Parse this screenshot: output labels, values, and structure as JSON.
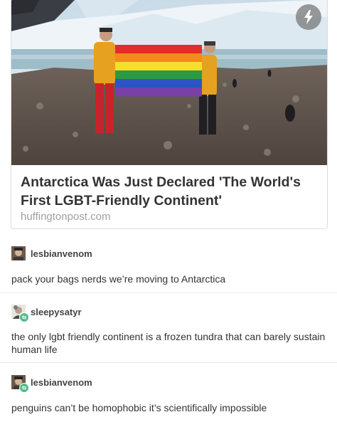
{
  "link_card": {
    "title": "Antarctica Was Just Declared 'The World's First LGBT-Friendly Continent'",
    "source": "huffingtonpost.com",
    "flag_colors": [
      "#e52b2b",
      "#f28a1c",
      "#f7de2b",
      "#2a9a46",
      "#2a55c8",
      "#7b3fa8"
    ]
  },
  "posts": [
    {
      "username": "lesbianvenom",
      "text": "pack your bags nerds we’re moving to Antarctica",
      "reblogged": false
    },
    {
      "username": "sleepysatyr",
      "text": "the only lgbt friendly continent is a frozen tundra that can barely sustain human life",
      "reblogged": true
    },
    {
      "username": "lesbianvenom",
      "text": "penguins can’t be homophobic it’s scientifically impossible",
      "reblogged": true
    }
  ],
  "colors": {
    "reblog_badge": "#56bc8a",
    "source_text": "#a0a0a0"
  }
}
